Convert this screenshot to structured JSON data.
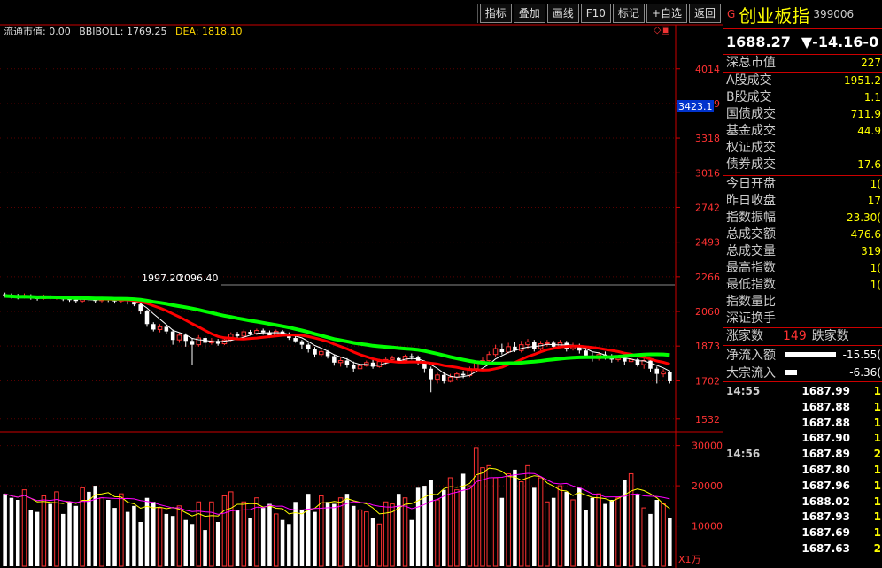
{
  "toolbar": {
    "buttons": [
      "指标",
      "叠加",
      "画线",
      "F10",
      "标记",
      "+自选",
      "返回"
    ]
  },
  "indicator_line": {
    "ltsz": "流通市值: 0.00",
    "bbiboll": "BBIBOLL: 1769.25",
    "dea": "DEA: 1818.10",
    "corner_icons": "◇▣"
  },
  "chart_labels": {
    "ma_annotation_1": "1997.20",
    "ma_annotation_2": "2096.40",
    "current_price_tag": "3423.1",
    "volume_unit": "X1万"
  },
  "colors": {
    "up": "#ff3232",
    "down": "#ffffff",
    "ma_red": "#ff0000",
    "ma_green": "#00ff00",
    "axis_text": "#ff3232"
  },
  "chart_data": [
    {
      "type": "candlestick",
      "title": "",
      "y_ticks": [
        4014,
        3649,
        3318,
        3016,
        2742,
        2493,
        2266,
        2060,
        1873,
        1702,
        1532
      ],
      "ylim": [
        1480,
        4400
      ],
      "scale": "log",
      "candles": [
        [
          2160,
          2150,
          2170,
          2140
        ],
        [
          2155,
          2145,
          2165,
          2135
        ],
        [
          2150,
          2140,
          2162,
          2130
        ],
        [
          2142,
          2150,
          2165,
          2135
        ],
        [
          2148,
          2138,
          2160,
          2128
        ],
        [
          2140,
          2132,
          2152,
          2122
        ],
        [
          2135,
          2145,
          2158,
          2128
        ],
        [
          2145,
          2138,
          2155,
          2130
        ],
        [
          2138,
          2140,
          2152,
          2128
        ],
        [
          2142,
          2130,
          2150,
          2120
        ],
        [
          2132,
          2125,
          2145,
          2115
        ],
        [
          2128,
          2120,
          2140,
          2110
        ],
        [
          2120,
          2135,
          2150,
          2112
        ],
        [
          2135,
          2128,
          2148,
          2118
        ],
        [
          2130,
          2120,
          2142,
          2108
        ],
        [
          2122,
          2130,
          2145,
          2112
        ],
        [
          2130,
          2124,
          2140,
          2114
        ],
        [
          2125,
          2118,
          2138,
          2105
        ],
        [
          2120,
          2128,
          2142,
          2110
        ],
        [
          2128,
          2120,
          2140,
          2100
        ],
        [
          2115,
          2100,
          2130,
          2090
        ],
        [
          2100,
          2060,
          2110,
          2045
        ],
        [
          2060,
          1990,
          2070,
          1975
        ],
        [
          1990,
          1960,
          2000,
          1950
        ],
        [
          1960,
          1975,
          1990,
          1945
        ],
        [
          1975,
          1950,
          1985,
          1935
        ],
        [
          1950,
          1905,
          1960,
          1880
        ],
        [
          1905,
          1930,
          1945,
          1890
        ],
        [
          1930,
          1900,
          1940,
          1870
        ],
        [
          1900,
          1880,
          1915,
          1780
        ],
        [
          1880,
          1915,
          1930,
          1870
        ],
        [
          1915,
          1890,
          1925,
          1860
        ],
        [
          1890,
          1900,
          1915,
          1880
        ],
        [
          1900,
          1885,
          1910,
          1875
        ],
        [
          1885,
          1905,
          1915,
          1878
        ],
        [
          1905,
          1935,
          1945,
          1898
        ],
        [
          1935,
          1925,
          1948,
          1915
        ],
        [
          1925,
          1948,
          1960,
          1918
        ],
        [
          1948,
          1938,
          1958,
          1928
        ],
        [
          1938,
          1955,
          1965,
          1930
        ],
        [
          1955,
          1945,
          1965,
          1932
        ],
        [
          1945,
          1928,
          1955,
          1915
        ],
        [
          1928,
          1950,
          1960,
          1920
        ],
        [
          1950,
          1935,
          1958,
          1925
        ],
        [
          1935,
          1915,
          1945,
          1905
        ],
        [
          1915,
          1898,
          1925,
          1890
        ],
        [
          1898,
          1880,
          1905,
          1860
        ],
        [
          1880,
          1858,
          1890,
          1840
        ],
        [
          1858,
          1830,
          1868,
          1815
        ],
        [
          1830,
          1845,
          1860,
          1820
        ],
        [
          1845,
          1822,
          1852,
          1810
        ],
        [
          1822,
          1790,
          1830,
          1775
        ],
        [
          1790,
          1800,
          1815,
          1770
        ],
        [
          1800,
          1780,
          1812,
          1765
        ],
        [
          1780,
          1760,
          1795,
          1745
        ],
        [
          1760,
          1775,
          1790,
          1735
        ],
        [
          1775,
          1790,
          1800,
          1770
        ],
        [
          1790,
          1770,
          1805,
          1760
        ],
        [
          1770,
          1795,
          1808,
          1765
        ],
        [
          1795,
          1805,
          1815,
          1780
        ],
        [
          1805,
          1812,
          1825,
          1795
        ],
        [
          1812,
          1800,
          1820,
          1790
        ],
        [
          1800,
          1822,
          1830,
          1795
        ],
        [
          1822,
          1815,
          1835,
          1805
        ],
        [
          1815,
          1790,
          1825,
          1780
        ],
        [
          1790,
          1760,
          1800,
          1740
        ],
        [
          1760,
          1710,
          1770,
          1650
        ],
        [
          1710,
          1730,
          1740,
          1690
        ],
        [
          1730,
          1700,
          1745,
          1690
        ],
        [
          1700,
          1720,
          1735,
          1695
        ],
        [
          1720,
          1735,
          1745,
          1705
        ],
        [
          1735,
          1728,
          1750,
          1715
        ],
        [
          1728,
          1760,
          1770,
          1720
        ],
        [
          1760,
          1790,
          1800,
          1755
        ],
        [
          1790,
          1800,
          1815,
          1780
        ],
        [
          1800,
          1830,
          1845,
          1795
        ],
        [
          1830,
          1860,
          1880,
          1820
        ],
        [
          1860,
          1842,
          1885,
          1830
        ],
        [
          1842,
          1870,
          1890,
          1835
        ],
        [
          1870,
          1850,
          1895,
          1842
        ],
        [
          1850,
          1880,
          1900,
          1840
        ],
        [
          1880,
          1895,
          1910,
          1860
        ],
        [
          1895,
          1860,
          1905,
          1845
        ],
        [
          1860,
          1885,
          1900,
          1850
        ],
        [
          1885,
          1890,
          1905,
          1870
        ],
        [
          1890,
          1870,
          1900,
          1858
        ],
        [
          1870,
          1890,
          1905,
          1862
        ],
        [
          1890,
          1860,
          1900,
          1845
        ],
        [
          1860,
          1875,
          1890,
          1850
        ],
        [
          1875,
          1850,
          1885,
          1835
        ],
        [
          1850,
          1825,
          1862,
          1815
        ],
        [
          1825,
          1810,
          1840,
          1795
        ],
        [
          1810,
          1830,
          1842,
          1800
        ],
        [
          1830,
          1820,
          1845,
          1805
        ],
        [
          1820,
          1805,
          1832,
          1790
        ],
        [
          1805,
          1812,
          1825,
          1795
        ],
        [
          1812,
          1795,
          1822,
          1780
        ],
        [
          1795,
          1805,
          1820,
          1790
        ],
        [
          1805,
          1780,
          1812,
          1770
        ],
        [
          1780,
          1800,
          1815,
          1760
        ],
        [
          1800,
          1760,
          1810,
          1742
        ],
        [
          1760,
          1735,
          1770,
          1690
        ],
        [
          1735,
          1745,
          1758,
          1720
        ],
        [
          1745,
          1700,
          1752,
          1690
        ]
      ],
      "ma_red_end": 1790,
      "ma_green_end": 1845
    },
    {
      "type": "bar",
      "title": "",
      "y_ticks": [
        10000,
        20000,
        30000
      ],
      "ylim": [
        0,
        33000
      ],
      "volumes": [
        18000,
        17000,
        16500,
        19000,
        14000,
        13500,
        17500,
        15500,
        18500,
        13000,
        16000,
        15000,
        19500,
        18500,
        20000,
        17000,
        16500,
        14500,
        18000,
        13500,
        15000,
        11000,
        17000,
        16000,
        14500,
        13000,
        12500,
        15000,
        11500,
        10500,
        16000,
        9000,
        16000,
        11000,
        17500,
        18500,
        14000,
        16000,
        12000,
        17000,
        14500,
        15500,
        13000,
        11500,
        10500,
        16000,
        14000,
        18000,
        13500,
        17500,
        16000,
        15500,
        17000,
        18000,
        15000,
        14000,
        13500,
        12000,
        10500,
        16000,
        15500,
        18000,
        17000,
        11500,
        19500,
        20000,
        21500,
        16500,
        19000,
        22000,
        19000,
        23000,
        20000,
        29500,
        24500,
        25000,
        22000,
        17000,
        23000,
        24000,
        21000,
        25000,
        19500,
        22000,
        16000,
        17000,
        20000,
        18500,
        16500,
        19500,
        14000,
        17000,
        18000,
        15500,
        16500,
        17000,
        21500,
        23000,
        18000,
        14500,
        13000,
        16500,
        15500,
        12000
      ],
      "ma_yellow_end": 17000,
      "ma_magenta_end": 16500
    }
  ],
  "panel": {
    "g_mark": "G",
    "name": "创业板指",
    "code": "399006",
    "price": "1688.27",
    "change": "▼-14.16-0",
    "market": [
      {
        "label": "深总市值",
        "value": "227"
      }
    ],
    "turnover": [
      {
        "label": "A股成交",
        "value": "1951.2"
      },
      {
        "label": "B股成交",
        "value": "1.1"
      },
      {
        "label": "国债成交",
        "value": "711.9"
      },
      {
        "label": "基金成交",
        "value": "44.9"
      },
      {
        "label": "权证成交",
        "value": ""
      },
      {
        "label": "债券成交",
        "value": "17.6"
      }
    ],
    "stats": [
      {
        "label": "今日开盘",
        "value": "1("
      },
      {
        "label": "昨日收盘",
        "value": "17"
      },
      {
        "label": "指数振幅",
        "value": "23.30("
      },
      {
        "label": "总成交额",
        "value": "476.6"
      },
      {
        "label": "总成交量",
        "value": "319"
      },
      {
        "label": "最高指数",
        "value": "1("
      },
      {
        "label": "最低指数",
        "value": "1("
      },
      {
        "label": "指数量比",
        "value": ""
      },
      {
        "label": "深证换手",
        "value": ""
      }
    ],
    "breadth": {
      "up_label": "涨家数",
      "up_value": "149",
      "down_label": "跌家数"
    },
    "flows": [
      {
        "label": "净流入额",
        "value": "-15.55(",
        "bar": 0.85
      },
      {
        "label": "大宗流入",
        "value": "-6.36(",
        "bar": 0.2
      }
    ],
    "ticks": [
      {
        "time": "14:55",
        "price": "1687.99",
        "vol": "1"
      },
      {
        "time": "",
        "price": "1687.88",
        "vol": "1"
      },
      {
        "time": "",
        "price": "1687.88",
        "vol": "1"
      },
      {
        "time": "",
        "price": "1687.90",
        "vol": "1"
      },
      {
        "time": "14:56",
        "price": "1687.89",
        "vol": "2"
      },
      {
        "time": "",
        "price": "1687.80",
        "vol": "1"
      },
      {
        "time": "",
        "price": "1687.96",
        "vol": "1"
      },
      {
        "time": "",
        "price": "1688.02",
        "vol": "1"
      },
      {
        "time": "",
        "price": "1687.93",
        "vol": "1"
      },
      {
        "time": "",
        "price": "1687.69",
        "vol": "1"
      },
      {
        "time": "",
        "price": "1687.63",
        "vol": "2"
      }
    ]
  }
}
